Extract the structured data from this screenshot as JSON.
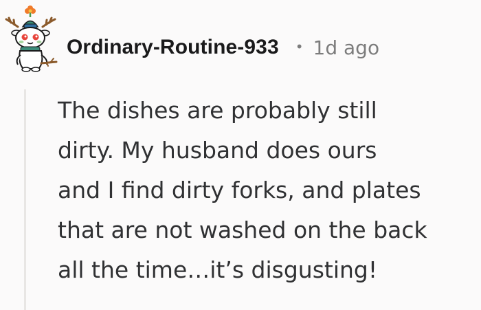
{
  "comment": {
    "author": "Ordinary-Routine-933",
    "separator": "•",
    "age": "1d ago",
    "avatar_icon": "snoo-reindeer-avatar-icon",
    "body_lines": [
      "The dishes are probably still",
      "dirty. My husband does ours",
      "and I find dirty forks, and plates",
      "that are not washed on the back",
      "all the time…it’s disgusting!"
    ]
  },
  "colors": {
    "background": "#fbfafa",
    "author_text": "#1a1a1b",
    "meta_text": "#7c7c7c",
    "body_text": "#303133",
    "thread_line": "#e8e6e4"
  }
}
